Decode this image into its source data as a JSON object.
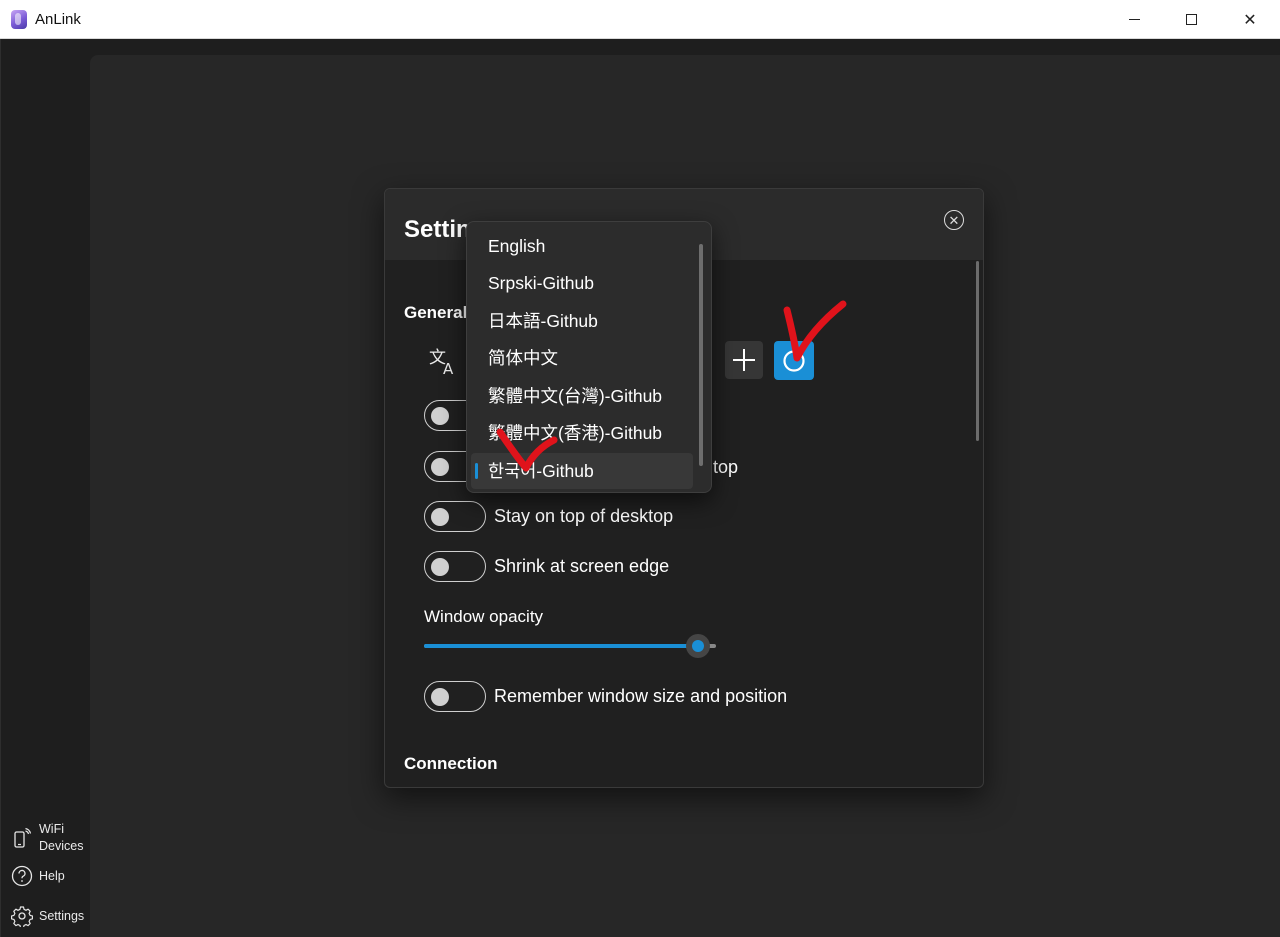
{
  "window": {
    "title": "AnLink",
    "minimize_glyph": "",
    "maximize_glyph": "",
    "close_glyph": "✕"
  },
  "nav": {
    "wifi_devices_line1": "WiFi",
    "wifi_devices_line2": "Devices",
    "help": "Help",
    "settings": "Settings"
  },
  "settings_dialog": {
    "title": "Settings",
    "close_glyph": "✕",
    "general_section": "General",
    "connection_section": "Connection",
    "toggles": [
      {
        "label": "",
        "on": false
      },
      {
        "label": "",
        "on": false
      },
      {
        "label": "Stay on top of desktop",
        "on": false
      },
      {
        "label": "Shrink at screen edge",
        "on": false
      },
      {
        "label": "Remember window size and position",
        "on": false
      }
    ],
    "partial_label_row2": "top",
    "window_opacity_label": "Window opacity",
    "window_opacity_value": 0.94
  },
  "language_dropdown": {
    "selected": "한국어-Github",
    "options": [
      "English",
      "Srpski-Github",
      "日本語-Github",
      "简体中文",
      "繁體中文(台灣)-Github",
      "繁體中文(香港)-Github",
      "한국어-Github"
    ]
  },
  "colors": {
    "accent": "#1a8fd6",
    "annotation": "#e0131b",
    "background": "#1e1e1e",
    "panel": "#272727",
    "dialog": "#202020"
  }
}
